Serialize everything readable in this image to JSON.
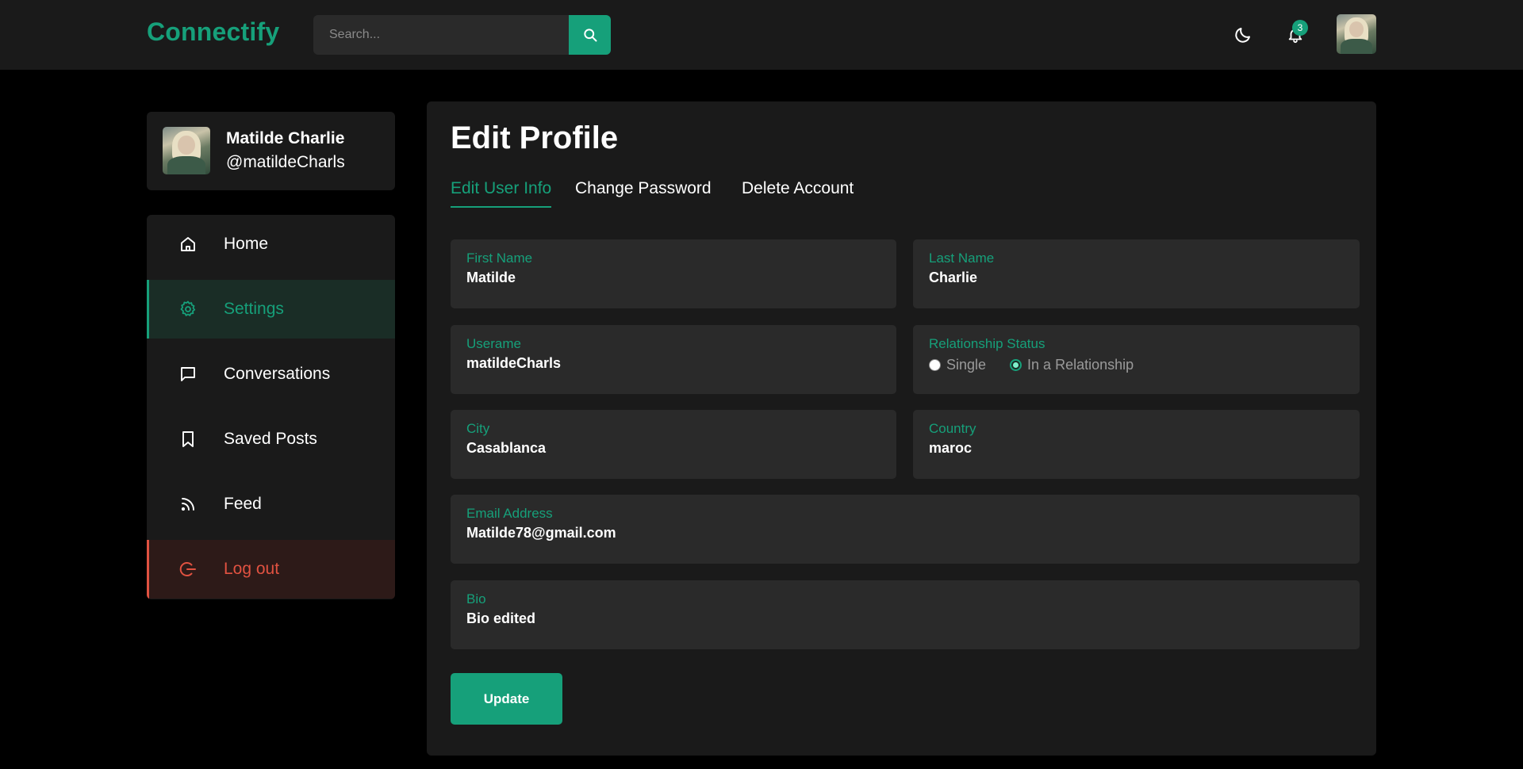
{
  "app": {
    "logo": "Connectify"
  },
  "header": {
    "search_placeholder": "Search...",
    "notification_count": "3",
    "icons": {
      "search": "search-icon",
      "theme": "moon-icon",
      "notifications": "bell-icon"
    }
  },
  "profile": {
    "name": "Matilde Charlie",
    "handle": "@matildeCharls"
  },
  "sidebar": {
    "items": [
      {
        "label": "Home",
        "icon": "home-icon"
      },
      {
        "label": "Settings",
        "icon": "gear-icon",
        "active": true
      },
      {
        "label": "Conversations",
        "icon": "chat-icon"
      },
      {
        "label": "Saved Posts",
        "icon": "bookmark-icon"
      },
      {
        "label": "Feed",
        "icon": "rss-icon"
      },
      {
        "label": "Log out",
        "icon": "logout-icon"
      }
    ]
  },
  "main": {
    "title": "Edit Profile",
    "tabs": [
      {
        "label": "Edit User Info",
        "active": true
      },
      {
        "label": "Change Password"
      },
      {
        "label": "Delete Account"
      }
    ],
    "fields": {
      "first_name": {
        "label": "First Name",
        "value": "Matilde"
      },
      "last_name": {
        "label": "Last Name",
        "value": "Charlie"
      },
      "username": {
        "label": "Userame",
        "value": "matildeCharls"
      },
      "relationship": {
        "label": "Relationship Status",
        "options": [
          "Single",
          "In a Relationship"
        ],
        "selected": "In a Relationship"
      },
      "city": {
        "label": "City",
        "value": "Casablanca"
      },
      "country": {
        "label": "Country",
        "value": "maroc"
      },
      "email": {
        "label": "Email Address",
        "value": "Matilde78@gmail.com"
      },
      "bio": {
        "label": "Bio",
        "value": "Bio edited"
      }
    },
    "update_label": "Update"
  },
  "colors": {
    "accent": "#16a07a",
    "danger": "#e15241",
    "background": "#000000",
    "panel": "#1a1a1a",
    "field": "#2a2a2a"
  }
}
